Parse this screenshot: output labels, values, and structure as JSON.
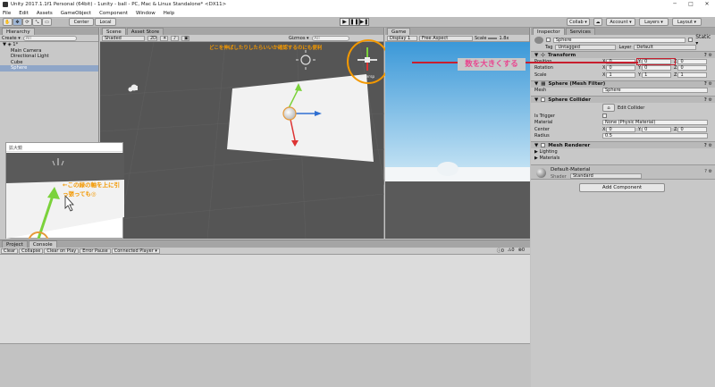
{
  "window": {
    "title": "Unity 2017.1.1f1 Personal (64bit) - 1unity - ball - PC, Mac & Linux Standalone* <DX11>",
    "minimize": "─",
    "maximize": "□",
    "close": "✕"
  },
  "menu": [
    "File",
    "Edit",
    "Assets",
    "GameObject",
    "Component",
    "Window",
    "Help"
  ],
  "toolbar": {
    "center": "Center",
    "local": "Local",
    "collab": "Collab ▾",
    "account": "Account ▾",
    "layers": "Layers ▾",
    "layout": "Layout ▾"
  },
  "hierarchy": {
    "tab": "Hierarchy",
    "create": "Create ▾",
    "search_placeholder": "All",
    "scene": "1*",
    "items": [
      "Main Camera",
      "Directional Light",
      "Cube",
      "Sphere"
    ]
  },
  "scene": {
    "tab": "Scene",
    "asset_store_tab": "Asset Store",
    "shading": "Shaded",
    "mode2d": "2D",
    "gizmos": "Gizmos ▾",
    "search_placeholder": "All",
    "persp": "◀ Persp",
    "annotation_top": "どこを伸ばしたりしたらいいか確認するのにも便利",
    "zoom_title": "拡大鏡",
    "annotation_drag": "←この緑の軸を上に引っ張っても◎"
  },
  "game": {
    "tab": "Game",
    "display": "Display 1",
    "aspect": "Free Aspect",
    "scale_label": "Scale",
    "scale": "1.8x"
  },
  "inspector": {
    "tab": "Inspector",
    "services_tab": "Services",
    "object_name": "Sphere",
    "static": "Static ▾",
    "tag_label": "Tag",
    "tag": "Untagged",
    "layer_label": "Layer",
    "layer": "Default",
    "transform": {
      "title": "Transform",
      "position_label": "Position",
      "rotation_label": "Rotation",
      "scale_label": "Scale",
      "position": [
        "0",
        "0",
        "0"
      ],
      "rotation": [
        "0",
        "0",
        "0"
      ],
      "scale": [
        "1",
        "1",
        "1"
      ]
    },
    "annotation": "数を大きくする",
    "mesh_filter": {
      "title": "Sphere (Mesh Filter)",
      "mesh_label": "Mesh",
      "mesh": "Sphere"
    },
    "collider": {
      "title": "Sphere Collider",
      "edit": "Edit Collider",
      "is_trigger": "Is Trigger",
      "material_label": "Material",
      "material": "None (Physic Material)",
      "center_label": "Center",
      "center": [
        "0",
        "0",
        "0"
      ],
      "radius_label": "Radius",
      "radius": "0.5"
    },
    "renderer": {
      "title": "Mesh Renderer",
      "lighting": "Lighting",
      "materials": "Materials"
    },
    "material": {
      "name": "Default-Material",
      "shader_label": "Shader",
      "shader": "Standard"
    },
    "add_component": "Add Component"
  },
  "console": {
    "project_tab": "Project",
    "console_tab": "Console",
    "buttons": [
      "Clear",
      "Collapse",
      "Clear on Play",
      "Error Pause",
      "Connected Player ▾"
    ],
    "counts": [
      "0",
      "0",
      "0"
    ]
  },
  "colors": {
    "annotation_orange": "#f39800",
    "annotation_pink": "#e8468f",
    "highlight_red": "#c81e2e"
  }
}
